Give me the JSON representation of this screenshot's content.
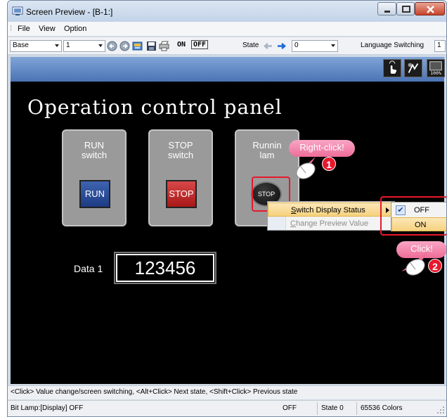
{
  "window": {
    "title": "Screen Preview - [B-1:]"
  },
  "menu": {
    "items": [
      "File",
      "View",
      "Option"
    ]
  },
  "toolbar": {
    "base_select": "Base",
    "screen_number": "1",
    "on_label": "ON",
    "off_label": "OFF",
    "state_label": "State",
    "state_value": "0",
    "language_label": "Language Switching",
    "language_value": "1"
  },
  "screen": {
    "title": "Operation control panel",
    "run_card": {
      "line1": "RUN",
      "line2": "switch",
      "button": "RUN"
    },
    "stop_card": {
      "line1": "STOP",
      "line2": "switch",
      "button": "STOP"
    },
    "lamp_card": {
      "line1": "Runnin",
      "line2": "lam",
      "lamp": "STOP"
    },
    "data_label": "Data 1",
    "data_value": "123456"
  },
  "context_menu": {
    "items": [
      {
        "label": "Switch Display Status",
        "accel": "S",
        "rest": "witch Display Status"
      },
      {
        "label": "Change Preview Value",
        "accel": "C",
        "rest": "hange Preview Value"
      }
    ]
  },
  "submenu": {
    "off": "OFF",
    "on": "ON"
  },
  "callouts": {
    "right_click": "Right-click!",
    "click": "Click!",
    "step1": "1",
    "step2": "2"
  },
  "status": {
    "hint": "<Click> Value change/screen switching, <Alt+Click> Next state, <Shift+Click> Previous state",
    "bit_lamp": "Bit Lamp:[Display] OFF",
    "value": "OFF",
    "state": "State 0",
    "colors": "65536 Colors"
  },
  "icons": [
    "app-icon",
    "minimize-icon",
    "maximize-icon",
    "close-icon",
    "back-icon",
    "forward-icon",
    "open-icon",
    "save-icon",
    "print-icon",
    "touch-icon",
    "sync-icon",
    "zoom-100-icon",
    "checkmark-icon",
    "mouse-icon",
    "submenu-arrow-icon",
    "dropdown-arrow-icon"
  ],
  "colors": {
    "accent_red": "#e8182c",
    "highlight": "#f6d27e",
    "callout_pink": "#ee6d99",
    "run_blue": "#1d3b84",
    "stop_red": "#a81818"
  }
}
